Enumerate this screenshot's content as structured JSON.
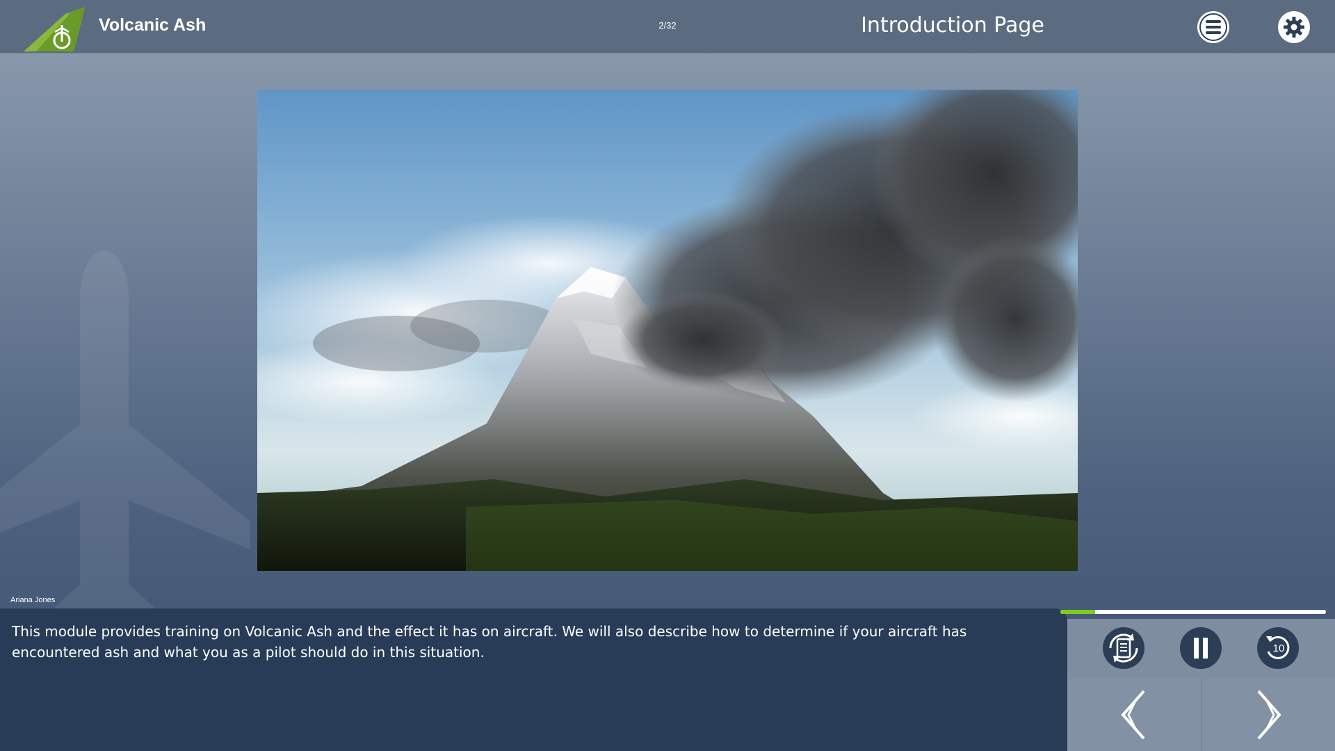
{
  "header": {
    "app_title": "Volcanic Ash",
    "page_counter": "2/32",
    "page_title": "Introduction Page",
    "menu_icon": "hamburger-menu-icon",
    "settings_icon": "gear-icon"
  },
  "hero_image": {
    "subject": "volcano-erupting-ash-cloud"
  },
  "narration": {
    "speaker": "Ariana Jones",
    "text": "This module provides training on Volcanic Ash and the effect it has on aircraft. We will also describe how to determine if your aircraft has encountered ash and what you as a pilot should do in this situation."
  },
  "player": {
    "progress": 0.13,
    "progress_color": "#7ecb1c",
    "transcript_icon": "transcript-refresh-icon",
    "pause_icon": "pause-icon",
    "replay_icon": "replay-10-icon",
    "prev_icon": "chevron-left-icon",
    "next_icon": "chevron-right-icon"
  },
  "colors": {
    "topbar": "#5c6c80",
    "transcript_panel": "#283c58",
    "brand_green": "#6a9a2a"
  }
}
